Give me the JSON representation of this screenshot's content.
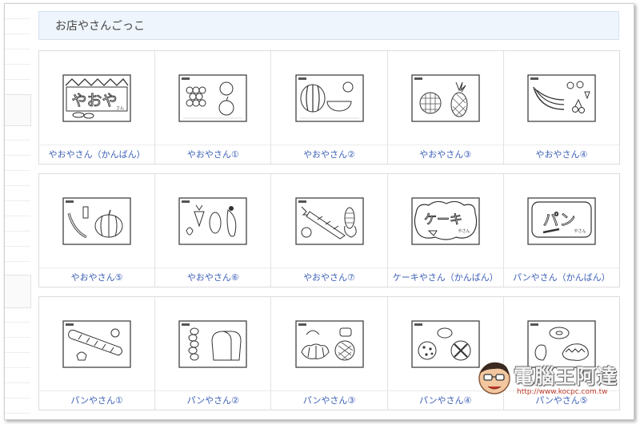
{
  "header": {
    "title": "お店やさんごっこ"
  },
  "rows": [
    {
      "items": [
        {
          "label": "やおやさん（かんばん）",
          "icon": "greengrocer-sign-thumbnail",
          "sign_text": "やおや",
          "sign_sub": "さん"
        },
        {
          "label": "やおやさん①",
          "icon": "grapes-apple-thumbnail"
        },
        {
          "label": "やおやさん②",
          "icon": "watermelon-thumbnail"
        },
        {
          "label": "やおやさん③",
          "icon": "melon-pineapple-thumbnail"
        },
        {
          "label": "やおやさん④",
          "icon": "banana-strawberry-thumbnail"
        }
      ]
    },
    {
      "items": [
        {
          "label": "やおやさん⑤",
          "icon": "pumpkin-cucumber-thumbnail"
        },
        {
          "label": "やおやさん⑥",
          "icon": "carrot-eggplant-thumbnail"
        },
        {
          "label": "やおやさん⑦",
          "icon": "daikon-corn-thumbnail"
        },
        {
          "label": "ケーキやさん（かんばん）",
          "icon": "cake-shop-sign-thumbnail",
          "sign_text": "ケーキ",
          "sign_sub": "やさん"
        },
        {
          "label": "パンやさん（かんばん）",
          "icon": "bakery-sign-thumbnail",
          "sign_text": "パン",
          "sign_sub": "やさん"
        }
      ]
    },
    {
      "items": [
        {
          "label": "パンやさん①",
          "icon": "baguette-thumbnail"
        },
        {
          "label": "パンやさん②",
          "icon": "bread-loaf-thumbnail"
        },
        {
          "label": "パンやさん③",
          "icon": "croissant-thumbnail"
        },
        {
          "label": "パンやさん④",
          "icon": "cookie-bread-thumbnail"
        },
        {
          "label": "パンやさん⑤",
          "icon": "donut-thumbnail"
        }
      ]
    }
  ],
  "watermark": {
    "text": "電腦王阿達",
    "url": "http://www.kocpc.com.tw"
  }
}
